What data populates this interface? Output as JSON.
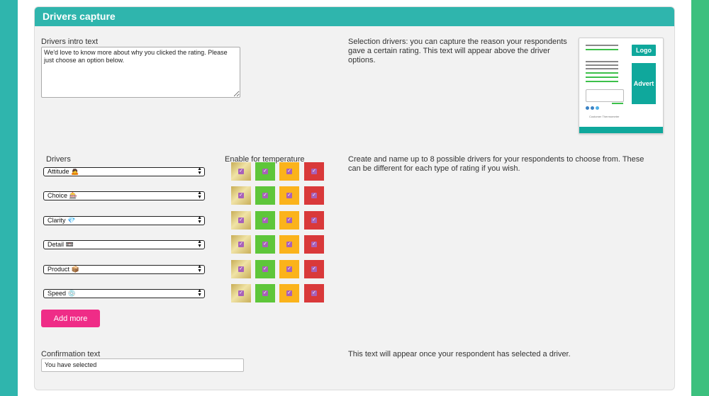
{
  "panel": {
    "title": "Drivers capture"
  },
  "intro": {
    "label": "Drivers intro text",
    "value": "We'd love to know more about why you clicked the rating. Please just choose an option below.",
    "help": "Selection drivers: you can capture the reason your respondents gave a certain rating. This text will appear above the driver options."
  },
  "preview": {
    "logo": "Logo",
    "advert": "Advert",
    "brand": "Customer Thermometer",
    "accent_color": "#0fa89c"
  },
  "drivers": {
    "label": "Drivers",
    "temp_label": "Enable for temperature",
    "help": "Create and name up to 8 possible drivers for your respondents to choose from. These can be different for each type of rating if you wish.",
    "items": [
      {
        "label": "Attitude",
        "emoji": "🙇",
        "checked": [
          true,
          true,
          true,
          true
        ]
      },
      {
        "label": "Choice",
        "emoji": "🎰",
        "checked": [
          true,
          true,
          true,
          true
        ]
      },
      {
        "label": "Clarity",
        "emoji": "💎",
        "checked": [
          true,
          true,
          true,
          true
        ]
      },
      {
        "label": "Detail",
        "emoji": "📼",
        "checked": [
          true,
          true,
          true,
          true
        ]
      },
      {
        "label": "Product",
        "emoji": "📦",
        "checked": [
          true,
          true,
          true,
          true
        ]
      },
      {
        "label": "Speed",
        "emoji": "💿",
        "checked": [
          true,
          true,
          true,
          true
        ]
      }
    ],
    "temperature_colors": [
      "#d8c47c",
      "#5ec63a",
      "#fbb31b",
      "#d9393a"
    ],
    "add_more": "Add more"
  },
  "confirmation": {
    "label": "Confirmation text",
    "value": "You have selected",
    "help": "This text will appear once your respondent has selected a driver."
  },
  "theme": {
    "header_color": "#2fb5ad",
    "left_edge": "#2fb5ad",
    "right_edge": "#3cc07e",
    "button_color": "#ef2c87"
  }
}
